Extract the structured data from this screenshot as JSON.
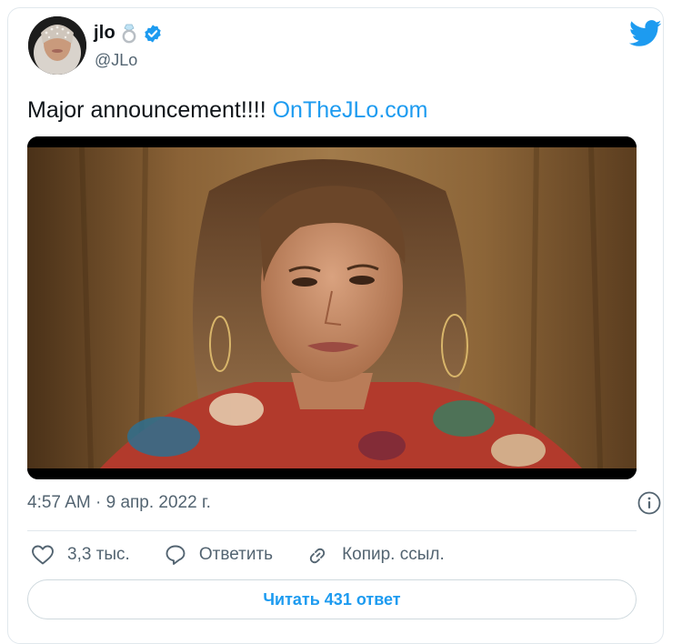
{
  "tweet": {
    "author": {
      "display_name": "jlo",
      "handle": "@JLo",
      "verified": true
    },
    "text": "Major announcement!!!! ",
    "link_text": "OnTheJLo.com",
    "timestamp": "4:57 AM · 9 апр. 2022 г."
  },
  "actions": {
    "like_count": "3,3 тыс.",
    "reply_label": "Ответить",
    "copy_link_label": "Копир. ссыл."
  },
  "read_replies_label": "Читать 431 ответ",
  "colors": {
    "accent": "#1d9bf0",
    "text_primary": "#0f1419",
    "text_secondary": "#536471",
    "border": "#e1e8ed"
  }
}
